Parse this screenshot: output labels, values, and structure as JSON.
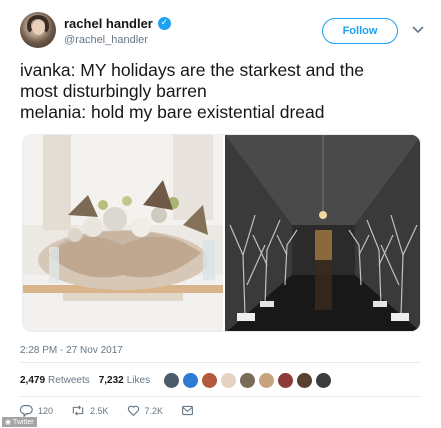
{
  "tweet": {
    "author_name": "rachel handler",
    "author_handle": "@rachel_handler",
    "follow_label": "Follow",
    "text_lines": [
      "ivanka: MY holidays are the starkest and the",
      "most disturbingly barren",
      "melania: hold my bare existential dread"
    ],
    "timestamp": "2:28 PM - 27 Nov 2017",
    "retweets_count": "2,479",
    "retweets_label": "Retweets",
    "likes_count": "7,232",
    "likes_label": "Likes",
    "reply_count": "120",
    "retweet_action_count": "2.5K",
    "like_action_count": "7.2K"
  },
  "icons": {
    "verified": "verified-badge-icon",
    "more": "chevron-down-icon",
    "reply": "reply-icon",
    "retweet": "retweet-icon",
    "like": "heart-icon",
    "message": "direct-message-icon"
  },
  "colors": {
    "accent": "#1da1f2",
    "text": "#14171a",
    "secondary": "#657786"
  }
}
